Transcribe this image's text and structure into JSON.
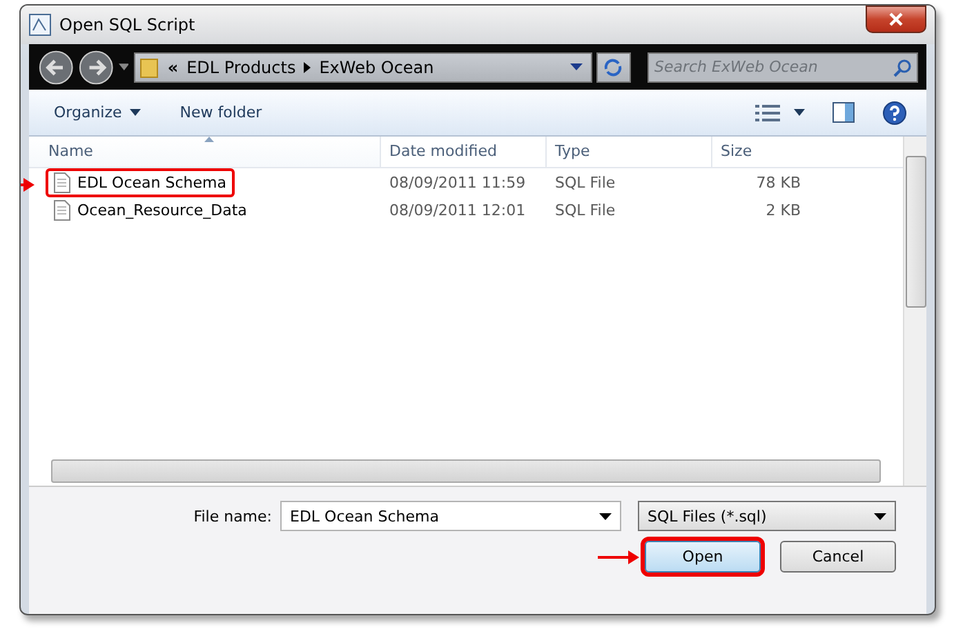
{
  "window": {
    "title": "Open SQL Script"
  },
  "nav": {
    "path": [
      {
        "label": "«"
      },
      {
        "label": "EDL Products"
      },
      {
        "label": "ExWeb Ocean"
      }
    ],
    "search": {
      "placeholder": "Search ExWeb Ocean"
    }
  },
  "toolbar": {
    "items": [
      "Organize",
      "New folder"
    ]
  },
  "table": {
    "columns": [
      {
        "label": "Name",
        "sorted": true
      },
      {
        "label": "Date modified",
        "sorted": false
      },
      {
        "label": "Type",
        "sorted": false
      },
      {
        "label": "Size",
        "sorted": false
      }
    ],
    "rows": [
      {
        "name": "EDL Ocean Schema",
        "date": "08/09/2011 11:59",
        "type": "SQL File",
        "size": "78 KB",
        "highlighted": true
      },
      {
        "name": "Ocean_Resource_Data",
        "date": "08/09/2011 12:01",
        "type": "SQL File",
        "size": "2 KB",
        "highlighted": false
      }
    ]
  },
  "footer": {
    "file_name_label": "File name:",
    "file_name": "EDL Ocean Schema",
    "file_type": "SQL Files (*.sql)",
    "buttons": [
      {
        "label": "Open",
        "highlighted": true
      },
      {
        "label": "Cancel",
        "highlighted": false
      }
    ]
  }
}
